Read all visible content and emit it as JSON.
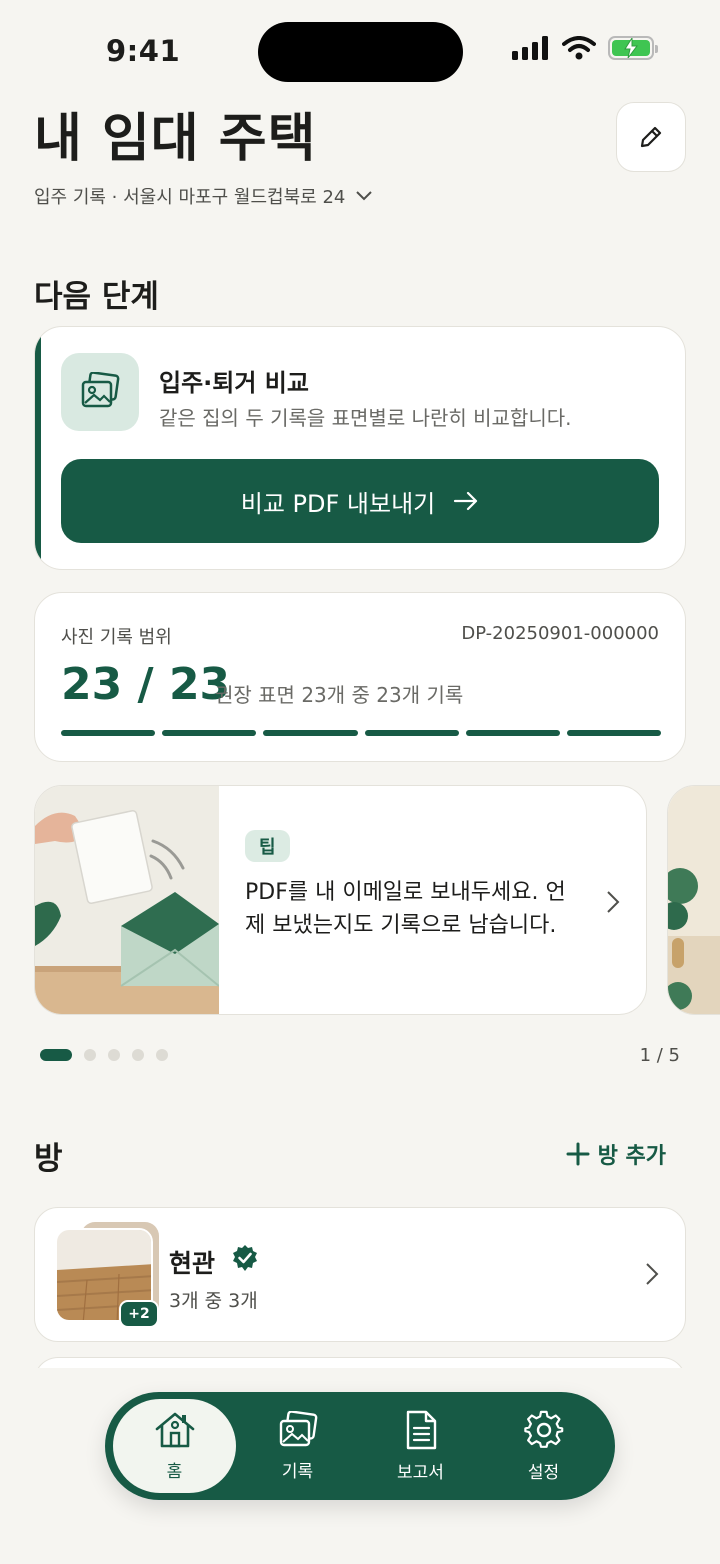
{
  "status_bar": {
    "time": "9:41"
  },
  "header": {
    "title": "내 임대 주택",
    "address": "입주 기록 · 서울시 마포구 월드컵북로 24"
  },
  "next_step": {
    "section_title": "다음 단계",
    "compare_title": "입주·퇴거 비교",
    "compare_subtitle": "같은 집의 두 기록을 표면별로 나란히 비교합니다.",
    "export_label": "비교 PDF 내보내기"
  },
  "photo_range": {
    "label": "사진 기록 범위",
    "code": "DP-20250901-000000",
    "count": "23 / 23",
    "recorded": 23,
    "total": 23,
    "description": "권장 표면 23개 중 23개 기록",
    "segments": 6
  },
  "tip": {
    "badge": "팁",
    "text": "PDF를 내 이메일로 보내두세요. 언제 보냈는지도 기록으로 남습니다.",
    "page_indicator": "1 / 5",
    "current_page": 1,
    "total_pages": 5
  },
  "rooms": {
    "section_title": "방",
    "add_label": "방 추가",
    "items": [
      {
        "name": "현관",
        "count": "3개 중 3개",
        "extra_photos": "+2",
        "verified": true
      }
    ]
  },
  "tab_bar": {
    "tabs": [
      {
        "label": "홈",
        "icon": "house-icon",
        "active": true
      },
      {
        "label": "기록",
        "icon": "photos-icon",
        "active": false
      },
      {
        "label": "보고서",
        "icon": "document-icon",
        "active": false
      },
      {
        "label": "설정",
        "icon": "gear-icon",
        "active": false
      }
    ]
  },
  "colors": {
    "accent": "#175a45",
    "accent_light": "#dcebe3",
    "background": "#f6f5f1",
    "battery": "#3fc552"
  }
}
